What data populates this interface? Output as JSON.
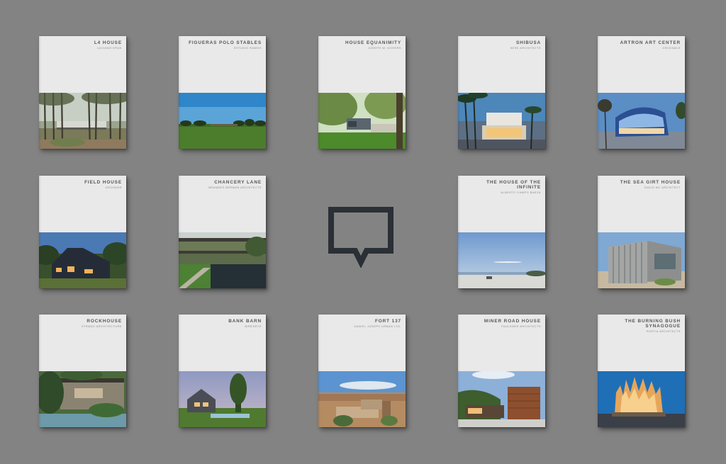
{
  "books": [
    {
      "title": "L4 HOUSE",
      "architect": "LUCIANO KRUK"
    },
    {
      "title": "FIGUERAS POLO STABLES",
      "architect": "ESTUDIO RAMOS"
    },
    {
      "title": "HOUSE EQUANIMITY",
      "architect": "JOSEPH W. DOHERS"
    },
    {
      "title": "SHIBUSA",
      "architect": "WISE ARCHITECTS"
    },
    {
      "title": "ARTRON ART CENTER",
      "architect": "ORIGINALE"
    },
    {
      "title": "FIELD HOUSE",
      "architect": "GROUNDS"
    },
    {
      "title": "CHANCERY LANE",
      "architect": "BRANDES BERMAN ARCHITECTS"
    },
    {
      "title": "THE HOUSE OF THE INFINITE",
      "architect": "ALBERTO CAMPO BAEZA"
    },
    {
      "title": "THE SEA GIRT HOUSE",
      "architect": "DAVID MC ARCHITECT"
    },
    {
      "title": "ROCKHOUSE",
      "architect": "STRANG ARCHITECTURE"
    },
    {
      "title": "BANK BARN",
      "architect": "BIRDSEYE"
    },
    {
      "title": "FORT 137",
      "architect": "DANIEL JOSEPH URBAN LTD."
    },
    {
      "title": "MINER ROAD HOUSE",
      "architect": "FAULKNER ARCHITECTS"
    },
    {
      "title": "THE BURNING BUSH SYNAGOGUE",
      "architect": "PORTIA ARCHITECTS"
    }
  ],
  "logo": {
    "icon": "speech-bubble-logo-icon",
    "color": "#2b2f36"
  }
}
